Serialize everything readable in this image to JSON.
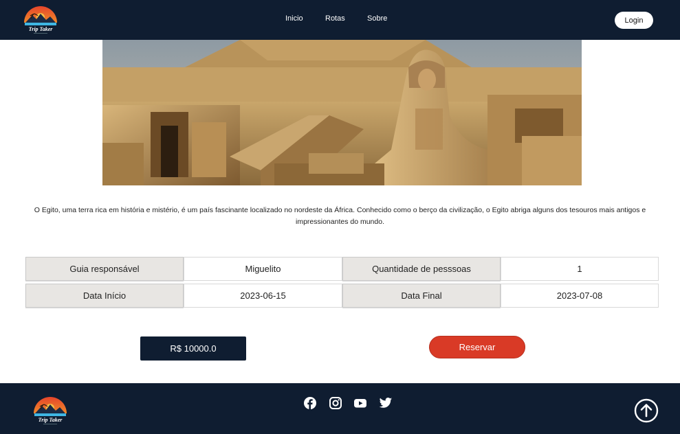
{
  "header": {
    "logo_text": "Trip Taker",
    "nav": [
      {
        "label": "Inicio"
      },
      {
        "label": "Rotas"
      },
      {
        "label": "Sobre"
      }
    ],
    "login_label": "Login"
  },
  "hero": {
    "icon": "egypt-sphinx-pyramid-photo"
  },
  "description": "O Egito, uma terra rica em história e mistério, é um país fascinante localizado no nordeste da África. Conhecido como o berço da civilização, o Egito abriga alguns dos tesouros mais antigos e impressionantes do mundo.",
  "details": {
    "guide_label": "Guia responsável",
    "guide_value": "Miguelito",
    "people_label": "Quantidade de pesssoas",
    "people_value": "1",
    "start_label": "Data Início",
    "start_value": "2023-06-15",
    "end_label": "Data Final",
    "end_value": "2023-07-08"
  },
  "actions": {
    "price": "R$ 10000.0",
    "reserve_label": "Reservar"
  },
  "footer": {
    "logo_text": "Trip Taker",
    "social": [
      "facebook-icon",
      "instagram-icon",
      "youtube-icon",
      "twitter-icon"
    ],
    "back_to_top_icon": "arrow-up-circle-icon"
  },
  "colors": {
    "navy": "#0f1d31",
    "accent_red": "#d93a26",
    "label_gray": "#e8e6e3"
  }
}
